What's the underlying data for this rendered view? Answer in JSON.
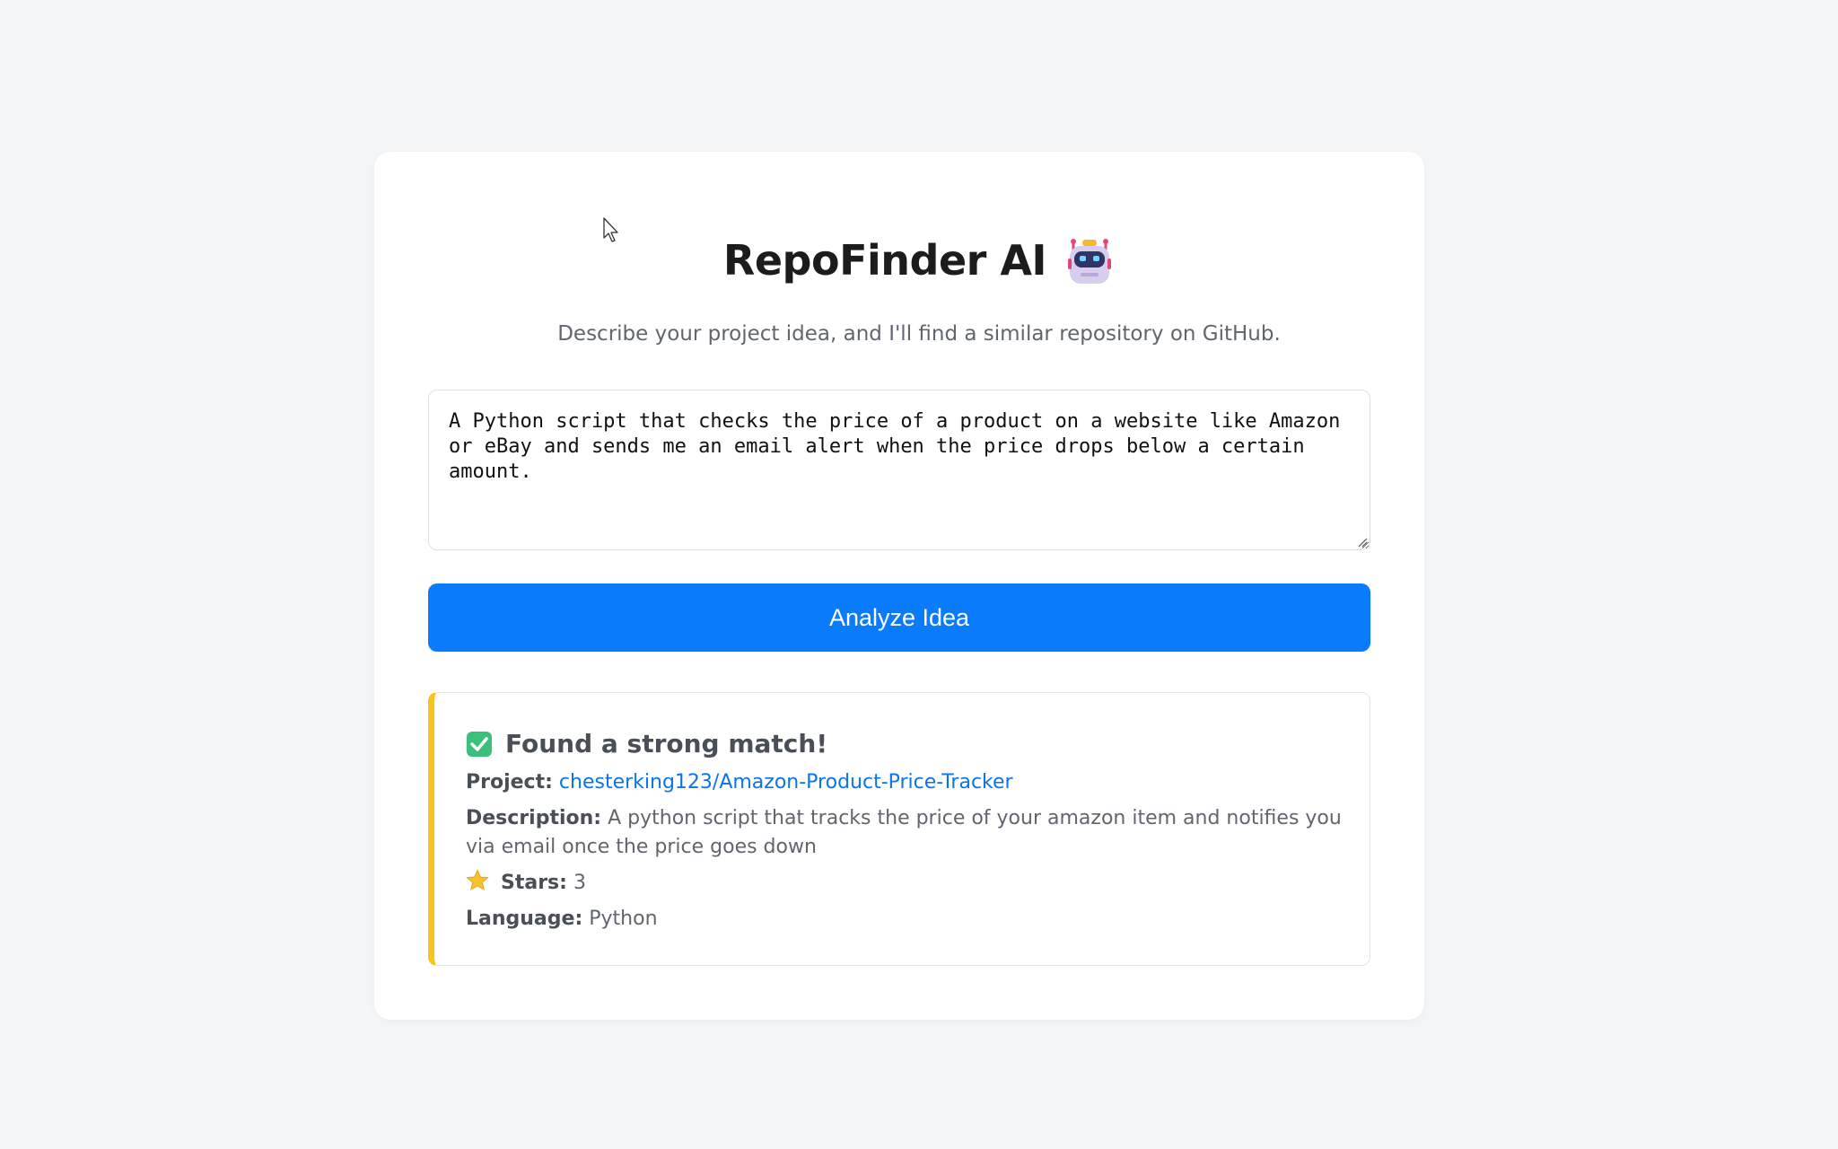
{
  "app": {
    "title": "RepoFinder AI",
    "title_icon": "robot-icon",
    "subtitle": "Describe your project idea, and I'll find a similar repository on GitHub."
  },
  "form": {
    "idea_value": "A Python script that checks the price of a product on a website like Amazon or eBay and sends me an email alert when the price drops below a certain amount.",
    "analyze_label": "Analyze Idea",
    "button_color": "#0a7bfb"
  },
  "result": {
    "heading_icon": "check-mark-icon",
    "heading": "Found a strong match!",
    "accent_color": "#f8c31b",
    "project_label": "Project:",
    "project_value": "chesterking123/Amazon-Product-Price-Tracker",
    "description_label": "Description:",
    "description_value": "A python script that tracks the price of your amazon item and notifies you via email once the price goes down",
    "stars_icon": "star-icon",
    "stars_label": "Stars:",
    "stars_value": "3",
    "language_label": "Language:",
    "language_value": "Python"
  }
}
